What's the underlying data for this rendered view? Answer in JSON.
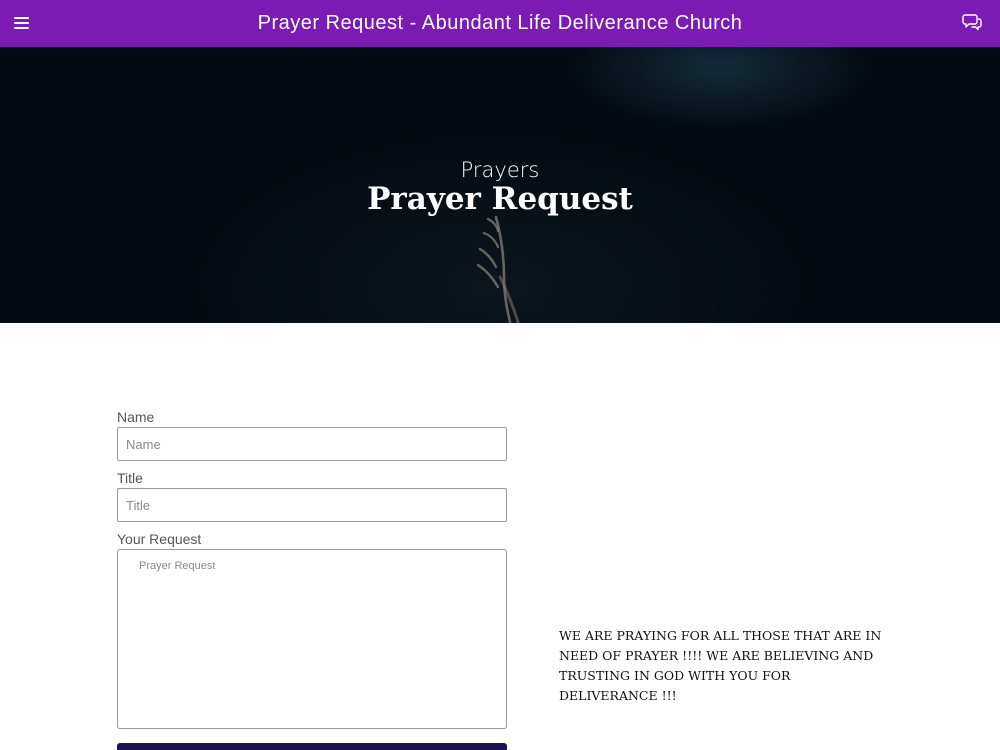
{
  "header": {
    "title": "Prayer Request - Abundant Life Deliverance Church",
    "menu_icon": "hamburger-menu-icon",
    "chat_icon": "chat-bubbles-icon",
    "background": "#7c1ab4"
  },
  "hero": {
    "kicker": "Prayers",
    "heading": "Prayer Request"
  },
  "form": {
    "name_label": "Name",
    "name_placeholder": "Name",
    "title_label": "Title",
    "title_placeholder": "Title",
    "request_label": "Your Request",
    "request_placeholder": "Prayer Request",
    "submit_color": "#1e1250"
  },
  "message": "WE ARE PRAYING FOR ALL THOSE THAT ARE IN NEED OF PRAYER !!!! WE ARE BELIEVING AND TRUSTING IN GOD WITH YOU FOR DELIVERANCE !!!"
}
